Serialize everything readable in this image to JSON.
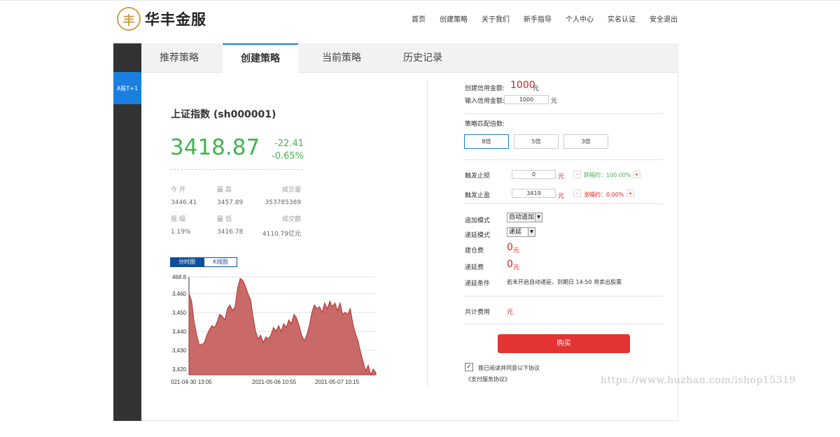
{
  "brand": {
    "logo_glyph": "丰",
    "name": "华丰金服"
  },
  "nav": [
    "首页",
    "创建策略",
    "关于我们",
    "新手指导",
    "个人中心",
    "实名认证",
    "安全退出"
  ],
  "sidebar": {
    "item": "A股T+1"
  },
  "tabs": [
    "推荐策略",
    "创建策略",
    "当前策略",
    "历史记录"
  ],
  "quote": {
    "name": "上证指数 (sh000001)",
    "price": "3418.87",
    "change": "-22.41",
    "change_pct": "-0.65%",
    "stats": {
      "open_label": "今 开",
      "open": "3446.41",
      "high_label": "最 高",
      "high": "3457.89",
      "volume_label": "成交量",
      "volume": "353785389",
      "amp_label": "振 幅",
      "amp": "1.19%",
      "low_label": "最 低",
      "low": "3416.78",
      "turnover_label": "成交额",
      "turnover": "4110.79亿元"
    }
  },
  "chart_tabs": [
    "分时图",
    "K线图"
  ],
  "chart_data": {
    "type": "area",
    "ylim": [
      3417,
      3468.8
    ],
    "yticks": [
      "3,420",
      "3,430",
      "3,440",
      "3,450",
      "3,460",
      "468.8"
    ],
    "ytick_values": [
      3420,
      3430,
      3440,
      3450,
      3460,
      3468.8
    ],
    "xticks": [
      "021-04-30 13:05",
      "2021-05-06 10:55",
      "2021-05-07 10:15"
    ],
    "color": "#c0504d",
    "values": [
      3460,
      3456,
      3445,
      3438,
      3433,
      3433,
      3434,
      3438,
      3441,
      3443,
      3442,
      3445,
      3449,
      3448,
      3446,
      3452,
      3454,
      3451,
      3453,
      3463,
      3468,
      3467,
      3464,
      3460,
      3457,
      3448,
      3440,
      3436,
      3438,
      3434,
      3437,
      3436,
      3438,
      3442,
      3440,
      3443,
      3440,
      3444,
      3442,
      3446,
      3444,
      3449,
      3447,
      3443,
      3438,
      3435,
      3438,
      3443,
      3450,
      3454,
      3452,
      3453,
      3450,
      3455,
      3452,
      3456,
      3453,
      3455,
      3451,
      3455,
      3449,
      3450,
      3449,
      3452,
      3444,
      3439,
      3435,
      3429,
      3424,
      3419,
      3422,
      3417,
      3420,
      3418
    ]
  },
  "form": {
    "credit_amount_label": "创建信用金额:",
    "credit_amount": "1000",
    "credit_unit": "元",
    "input_credit_label": "输入信用金额:",
    "input_credit_value": "1000",
    "input_credit_unit": "元",
    "multiple_label": "策略匹配倍数:",
    "multiples": [
      "8倍",
      "5倍",
      "3倍"
    ],
    "stop_loss_label": "触发止损",
    "stop_loss_value": "0",
    "stop_loss_unit": "元",
    "stop_loss_pct": "跌幅约：100.00%",
    "take_profit_label": "触发止盈",
    "take_profit_value": "3419",
    "take_profit_unit": "元",
    "take_profit_pct": "涨幅约：0.00%",
    "minus": "-",
    "plus": "+",
    "add_mode_label": "追加模式",
    "add_mode_value": "自动追加",
    "defer_mode_label": "递延模式",
    "defer_mode_value": "递延",
    "open_fee_label": "建仓费",
    "open_fee": "0",
    "open_fee_unit": "元",
    "defer_fee_label": "递延费",
    "defer_fee": "0",
    "defer_fee_unit": "元",
    "defer_cond_label": "递延条件",
    "defer_cond_text": "若未开启自动递延，到期日 14:50 将卖出股票",
    "total_label": "共计费用",
    "total_unit": "元",
    "buy_label": "购买",
    "agree_text": "我已阅读并同意以下协议",
    "agreement_link": "《支付服务协议》"
  },
  "watermark": "https://www.huzhan.com/ishop15319"
}
